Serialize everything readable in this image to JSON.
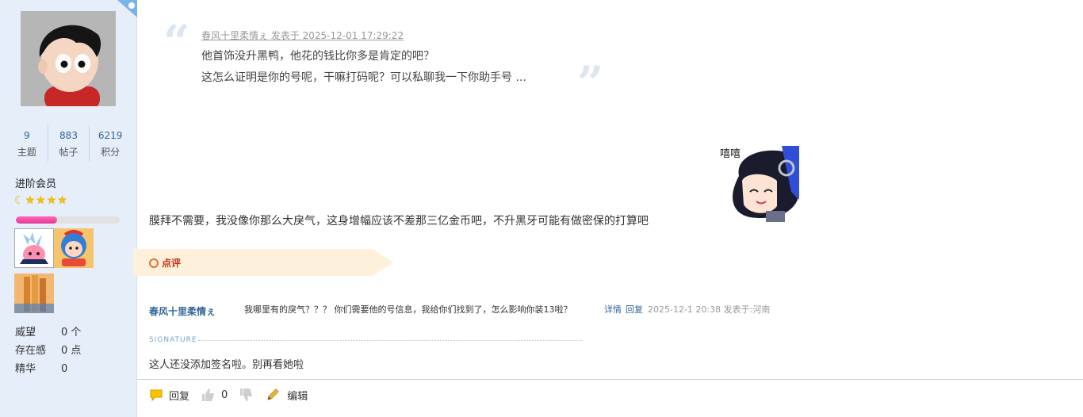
{
  "sidebar": {
    "stats": [
      {
        "value": "9",
        "label": "主题"
      },
      {
        "value": "883",
        "label": "帖子"
      },
      {
        "value": "6219",
        "label": "积分"
      }
    ],
    "rank": "进阶会员",
    "progress": 0.4,
    "meta": [
      {
        "key": "威望",
        "value": "0 个"
      },
      {
        "key": "存在感",
        "value": "0 点"
      },
      {
        "key": "精华",
        "value": "0"
      }
    ]
  },
  "quote": {
    "header": "春风十里柔情ぇ 发表于 2025-12-01 17:29:22",
    "line1": "他首饰没升黑鸭，他花的钱比你多是肯定的吧？",
    "line2": "这怎么证明是你的号呢，干嘛打码呢？可以私聊我一下你助手号 ..."
  },
  "post": {
    "text": "膜拜不需要，我没像你那么大戾气，这身增幅应该不差那三亿金币吧，不升黑牙可能有做密保的打算吧",
    "sticker_text": "嘻嘻"
  },
  "comment": {
    "banner_label": "点评",
    "user": "春风十里柔情ぇ",
    "text": "我哪里有的戾气？？？ 你们需要他的号信息，我给你们找到了，怎么影响你装13啦？",
    "detail_label": "详情",
    "reply_label": "回复",
    "time": "2025-12-1 20:38 发表于:河南"
  },
  "signature": {
    "label": "SIGNATURE",
    "text": "这人还没添加签名啦。别再看她啦"
  },
  "actions": {
    "reply": "回复",
    "likes": "0",
    "edit": "编辑"
  },
  "colors": {
    "sidebar_bg": "#e5eef9",
    "link": "#336699",
    "comment_banner": "#fdf1dc",
    "progress": "#e23a95"
  }
}
